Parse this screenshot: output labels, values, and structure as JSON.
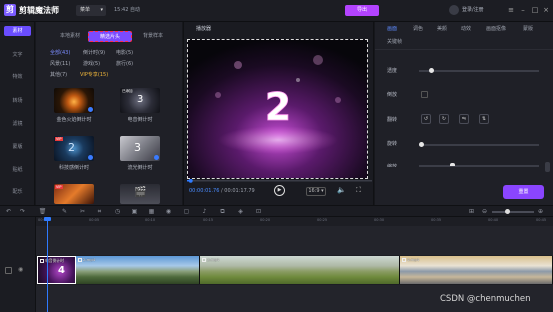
{
  "app": {
    "name": "剪辑魔法师",
    "logo_letter": "剪",
    "menu_label": "菜单",
    "clock": "15:42 自动",
    "export_label": "导出",
    "login_label": "登录/注册"
  },
  "sidebar": {
    "selected": "素材",
    "items": [
      "文字",
      "特效",
      "转场",
      "滤镜",
      "蒙版",
      "贴纸",
      "配乐"
    ]
  },
  "library": {
    "tabs": [
      "本地素材",
      "精选片头",
      "背景样本"
    ],
    "active_tab": 1,
    "categories": [
      {
        "label": "全部(43)",
        "selected": true
      },
      {
        "label": "倒计时(9)"
      },
      {
        "label": "电影(5)"
      },
      {
        "label": "风景(11)"
      },
      {
        "label": "游戏(5)"
      },
      {
        "label": "旅行(6)"
      },
      {
        "label": "其他(7)"
      },
      {
        "label": "VIP专享(15)",
        "vip": true
      }
    ],
    "thumbs": [
      {
        "label": "金色火焰倒计时",
        "vip": false
      },
      {
        "label": "电音倒计时",
        "vip": false,
        "tag": "已添加"
      },
      {
        "label": "科技感倒计时",
        "vip": true
      },
      {
        "label": "流光倒计时",
        "vip": false
      },
      {
        "label": "",
        "vip": true
      },
      {
        "label": "",
        "vip": false
      }
    ],
    "vip_text": "VIP"
  },
  "player": {
    "title": "播放器",
    "big_number": "2",
    "time_current": "00:00:01.76",
    "time_total": "00:01:17.79",
    "ratio": "16:9",
    "progress": 0.02
  },
  "props": {
    "tabs": [
      "画面",
      "调色",
      "美颜",
      "动效",
      "画面抠像",
      "蒙版"
    ],
    "selected_tab": 0,
    "subtab": "关键帧",
    "labels": [
      "透度",
      "倒放",
      "翻转",
      "旋转",
      "缩放"
    ],
    "opacity_level": 0.08,
    "rotate_level": 0.0,
    "reset_label": "重置"
  },
  "timeline": {
    "ruler": [
      "00:00",
      "00:05",
      "00:10",
      "00:15",
      "00:20",
      "00:25",
      "00:30",
      "00:35",
      "00:40",
      "00:45"
    ],
    "clips": [
      "电音倒计时",
      "2.mp4",
      "3.mp4",
      "4.mp4"
    ]
  },
  "watermark": "CSDN @chenmuchen"
}
